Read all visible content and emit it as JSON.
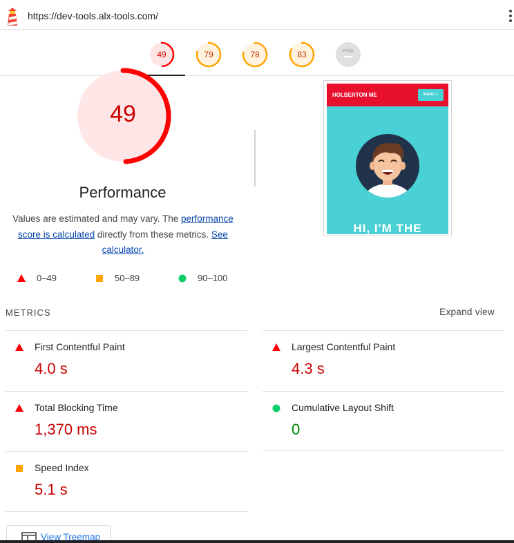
{
  "address_bar": {
    "url": "https://dev-tools.alx-tools.com/",
    "logo_icon": "lighthouse-icon",
    "menu_icon": "kebab-menu-icon"
  },
  "scores": [
    {
      "value": "49",
      "percent": 49,
      "status": "fail"
    },
    {
      "value": "79",
      "percent": 79,
      "status": "average"
    },
    {
      "value": "78",
      "percent": 78,
      "status": "average"
    },
    {
      "value": "83",
      "percent": 83,
      "status": "average"
    },
    {
      "value": "PWA",
      "percent": 0,
      "status": "na"
    }
  ],
  "performance": {
    "score": "49",
    "percent": 49,
    "title": "Performance",
    "desc_prefix": "Values are estimated and may vary. The ",
    "desc_link1": "performance score is calculated",
    "desc_middle": " directly from these metrics. ",
    "desc_link2": "See calculator."
  },
  "legend": [
    {
      "icon": "red-triangle-icon",
      "range": "0–49"
    },
    {
      "icon": "orange-square-icon",
      "range": "50–89"
    },
    {
      "icon": "green-circle-icon",
      "range": "90–100"
    }
  ],
  "screenshot": {
    "brand": "HOLBERTON ME",
    "menu": "MENU ≡",
    "hero": "HI, I'M THE"
  },
  "metrics": {
    "section_label": "METRICS",
    "expand_label": "Expand view",
    "items": [
      {
        "title": "First Contentful Paint",
        "value": "4.0 s",
        "status": "fail"
      },
      {
        "title": "Largest Contentful Paint",
        "value": "4.3 s",
        "status": "fail"
      },
      {
        "title": "Total Blocking Time",
        "value": "1,370 ms",
        "status": "fail"
      },
      {
        "title": "Cumulative Layout Shift",
        "value": "0",
        "status": "pass"
      },
      {
        "title": "Speed Index",
        "value": "5.1 s",
        "status": "average"
      }
    ]
  },
  "treemap": {
    "label": "View Treemap",
    "icon": "treemap-icon"
  },
  "colors": {
    "fail": "#ff0000",
    "fail_text": "#cc0000",
    "average": "#ffa400",
    "pass": "#0cce6b",
    "pass_text": "#008800",
    "link": "#0645ad"
  }
}
